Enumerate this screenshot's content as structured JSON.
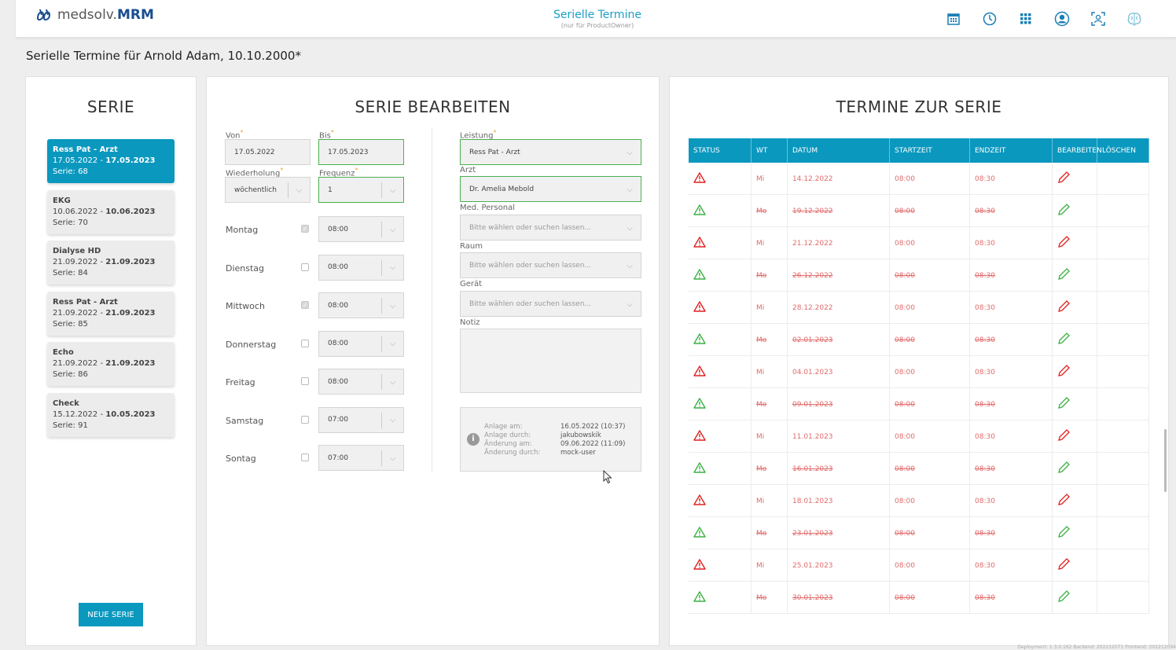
{
  "header": {
    "logo_prefix": "medsolv.",
    "logo_brand": "MRM",
    "title": "Serielle Termine",
    "subtitle": "(nur für ProductOwner)",
    "icons": [
      "calendar-icon",
      "clock-icon",
      "grid-icon",
      "user-icon",
      "scan-icon",
      "brain-icon"
    ]
  },
  "page_title": "Serielle Termine für Arnold Adam, 10.10.2000*",
  "serie": {
    "title": "SERIE",
    "items": [
      {
        "name": "Ress Pat - Arzt",
        "from": "17.05.2022",
        "sep": " - ",
        "to": "17.05.2023",
        "serie": "Serie: 68",
        "active": true
      },
      {
        "name": "EKG",
        "from": "10.06.2022",
        "sep": " - ",
        "to": "10.06.2023",
        "serie": "Serie: 70",
        "active": false
      },
      {
        "name": "Dialyse HD",
        "from": "21.09.2022",
        "sep": " - ",
        "to": "21.09.2023",
        "serie": "Serie: 84",
        "active": false
      },
      {
        "name": "Ress Pat - Arzt",
        "from": "21.09.2022",
        "sep": " - ",
        "to": "21.09.2023",
        "serie": "Serie: 85",
        "active": false
      },
      {
        "name": "Echo",
        "from": "21.09.2022",
        "sep": " - ",
        "to": "21.09.2023",
        "serie": "Serie: 86",
        "active": false
      },
      {
        "name": "Check",
        "from": "15.12.2022",
        "sep": " - ",
        "to": "10.05.2023",
        "serie": "Serie: 91",
        "active": false
      }
    ],
    "new_button": "NEUE SERIE"
  },
  "edit": {
    "title": "SERIE BEARBEITEN",
    "von_label": "Von",
    "von_value": "17.05.2022",
    "bis_label": "Bis",
    "bis_value": "17.05.2023",
    "wiederholung_label": "Wiederholung",
    "wiederholung_value": "wöchentlich",
    "frequenz_label": "Frequenz",
    "frequenz_value": "1",
    "days": [
      {
        "name": "Montag",
        "checked": true,
        "time": "08:00"
      },
      {
        "name": "Dienstag",
        "checked": false,
        "time": "08:00"
      },
      {
        "name": "Mittwoch",
        "checked": true,
        "time": "08:00"
      },
      {
        "name": "Donnerstag",
        "checked": false,
        "time": "08:00"
      },
      {
        "name": "Freitag",
        "checked": false,
        "time": "08:00"
      },
      {
        "name": "Samstag",
        "checked": false,
        "time": "07:00"
      },
      {
        "name": "Sontag",
        "checked": false,
        "time": "07:00"
      }
    ],
    "leistung_label": "Leistung",
    "leistung_value": "Ress Pat - Arzt",
    "arzt_label": "Arzt",
    "arzt_value": "Dr. Amelia Mebold",
    "personal_label": "Med. Personal",
    "personal_placeholder": "Bitte wählen oder suchen lassen...",
    "raum_label": "Raum",
    "raum_placeholder": "Bitte wählen oder suchen lassen...",
    "geraet_label": "Gerät",
    "geraet_placeholder": "Bitte wählen oder suchen lassen...",
    "notiz_label": "Notiz",
    "meta": {
      "anlage_am_label": "Anlage am:",
      "anlage_am": "16.05.2022 (10:37)",
      "anlage_durch_label": "Anlage durch:",
      "anlage_durch": "jakubowskik",
      "aenderung_am_label": "Änderung am:",
      "aenderung_am": "09.06.2022 (11:09)",
      "aenderung_durch_label": "Änderung durch:",
      "aenderung_durch": "mock-user"
    }
  },
  "termine": {
    "title": "TERMINE ZUR SERIE",
    "columns": [
      "STATUS",
      "WT",
      "DATUM",
      "STARTZEIT",
      "ENDZEIT",
      "BEARBEITEN",
      "LÖSCHEN"
    ],
    "rows": [
      {
        "status": "red",
        "wt": "Mi",
        "datum": "14.12.2022",
        "start": "08:00",
        "end": "08:30",
        "strike": false
      },
      {
        "status": "green",
        "wt": "Mo",
        "datum": "19.12.2022",
        "start": "08:00",
        "end": "08:30",
        "strike": true
      },
      {
        "status": "red",
        "wt": "Mi",
        "datum": "21.12.2022",
        "start": "08:00",
        "end": "08:30",
        "strike": false
      },
      {
        "status": "green",
        "wt": "Mo",
        "datum": "26.12.2022",
        "start": "08:00",
        "end": "08:30",
        "strike": true
      },
      {
        "status": "red",
        "wt": "Mi",
        "datum": "28.12.2022",
        "start": "08:00",
        "end": "08:30",
        "strike": false
      },
      {
        "status": "green",
        "wt": "Mo",
        "datum": "02.01.2023",
        "start": "08:00",
        "end": "08:30",
        "strike": true
      },
      {
        "status": "red",
        "wt": "Mi",
        "datum": "04.01.2023",
        "start": "08:00",
        "end": "08:30",
        "strike": false
      },
      {
        "status": "green",
        "wt": "Mo",
        "datum": "09.01.2023",
        "start": "08:00",
        "end": "08:30",
        "strike": true
      },
      {
        "status": "red",
        "wt": "Mi",
        "datum": "11.01.2023",
        "start": "08:00",
        "end": "08:30",
        "strike": false
      },
      {
        "status": "green",
        "wt": "Mo",
        "datum": "16.01.2023",
        "start": "08:00",
        "end": "08:30",
        "strike": true
      },
      {
        "status": "red",
        "wt": "Mi",
        "datum": "18.01.2023",
        "start": "08:00",
        "end": "08:30",
        "strike": false
      },
      {
        "status": "green",
        "wt": "Mo",
        "datum": "23.01.2023",
        "start": "08:00",
        "end": "08:30",
        "strike": true
      },
      {
        "status": "red",
        "wt": "Mi",
        "datum": "25.01.2023",
        "start": "08:00",
        "end": "08:30",
        "strike": false
      },
      {
        "status": "green",
        "wt": "Mo",
        "datum": "30.01.2023",
        "start": "08:00",
        "end": "08:30",
        "strike": true
      }
    ]
  },
  "footer": "Deployment: 1.3.0.162 Backend: 202212071 Frontend: 202212094",
  "colors": {
    "accent": "#0a98bf",
    "danger": "#e02020",
    "ok": "#3cb043",
    "text_red": "#e06b6b"
  }
}
